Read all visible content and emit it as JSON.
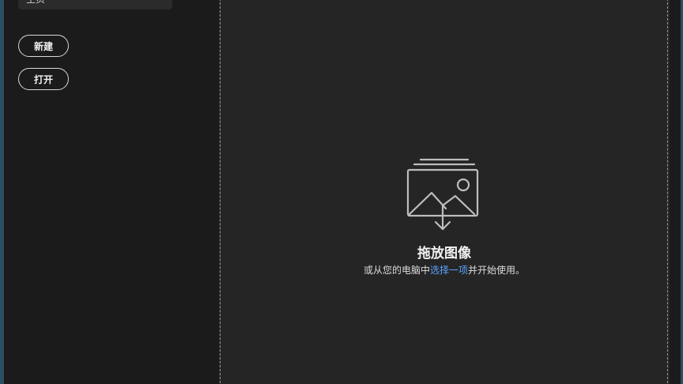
{
  "sidebar": {
    "home_label": "主页",
    "new_button": "新建",
    "open_button": "打开"
  },
  "dropzone": {
    "title": "拖放图像",
    "subtitle_prefix": "或从您的电脑中",
    "subtitle_link": "选择一项",
    "subtitle_suffix": "并开始使用。",
    "icon": "image-upload-icon"
  },
  "colors": {
    "sidebar_bg": "#1b1b1b",
    "main_bg": "#252525",
    "link": "#5aa3ff",
    "window_edge": "#2a4f63"
  }
}
